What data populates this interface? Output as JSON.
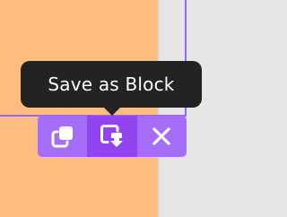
{
  "tooltip": {
    "text": "Save as Block"
  },
  "toolbar": {
    "buttons": [
      {
        "id": "duplicate",
        "icon": "duplicate-icon",
        "active": false
      },
      {
        "id": "save-as-block",
        "icon": "save-block-icon",
        "active": true
      },
      {
        "id": "delete",
        "icon": "close-icon",
        "active": false
      }
    ]
  },
  "colors": {
    "block_fill": "#ffbe7f",
    "selection_accent": "#9b63f5",
    "toolbar_bg": "#a56ef8",
    "toolbar_active": "#9144f0",
    "tooltip_bg": "#232323"
  }
}
